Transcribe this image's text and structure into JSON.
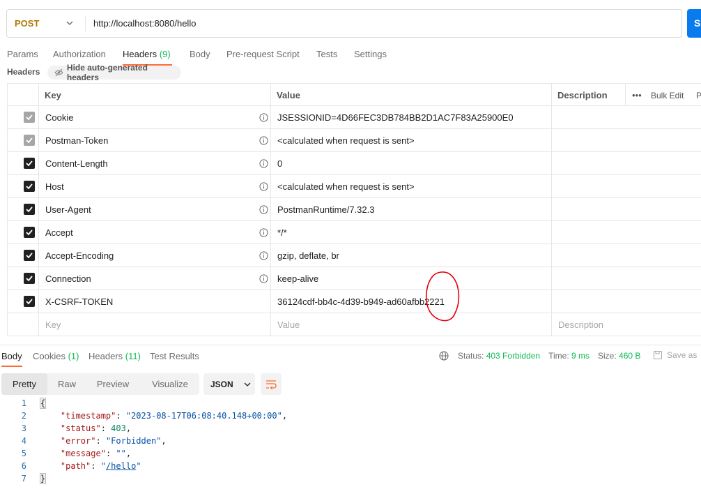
{
  "request": {
    "method": "POST",
    "url": "http://localhost:8080/hello",
    "send_label": "S"
  },
  "request_tabs": {
    "params": "Params",
    "authorization": "Authorization",
    "headers": "Headers",
    "headers_count": "(9)",
    "body": "Body",
    "prerequest": "Pre-request Script",
    "tests": "Tests",
    "settings": "Settings"
  },
  "headers_section": {
    "title": "Headers",
    "hide_auto": "Hide auto-generated headers"
  },
  "table": {
    "col_key": "Key",
    "col_value": "Value",
    "col_description": "Description",
    "bulk_edit": "Bulk Edit",
    "presets": "P",
    "rows": [
      {
        "checked": true,
        "auto": true,
        "key": "Cookie",
        "value": "JSESSIONID=4D66FEC3DB784BB2D1AC7F83A25900E0"
      },
      {
        "checked": true,
        "auto": true,
        "key": "Postman-Token",
        "value": "<calculated when request is sent>"
      },
      {
        "checked": true,
        "auto": false,
        "key": "Content-Length",
        "value": "0"
      },
      {
        "checked": true,
        "auto": false,
        "key": "Host",
        "value": "<calculated when request is sent>"
      },
      {
        "checked": true,
        "auto": false,
        "key": "User-Agent",
        "value": "PostmanRuntime/7.32.3"
      },
      {
        "checked": true,
        "auto": false,
        "key": "Accept",
        "value": "*/*"
      },
      {
        "checked": true,
        "auto": false,
        "key": "Accept-Encoding",
        "value": "gzip, deflate, br"
      },
      {
        "checked": true,
        "auto": false,
        "key": "Connection",
        "value": "keep-alive"
      },
      {
        "checked": true,
        "auto": false,
        "key": "X-CSRF-TOKEN",
        "value": "36124cdf-bb4c-4d39-b949-ad60afbb2221"
      }
    ],
    "placeholder_key": "Key",
    "placeholder_value": "Value",
    "placeholder_description": "Description"
  },
  "response": {
    "tabs": {
      "body": "Body",
      "cookies": "Cookies",
      "cookies_count": "(1)",
      "headers": "Headers",
      "headers_count": "(11)",
      "test_results": "Test Results"
    },
    "status_label": "Status:",
    "status_value": "403 Forbidden",
    "time_label": "Time:",
    "time_value": "9 ms",
    "size_label": "Size:",
    "size_value": "460 B",
    "save_as": "Save as"
  },
  "view": {
    "pretty": "Pretty",
    "raw": "Raw",
    "preview": "Preview",
    "visualize": "Visualize",
    "format": "JSON"
  },
  "code": {
    "line_numbers": [
      "1",
      "2",
      "3",
      "4",
      "5",
      "6",
      "7"
    ],
    "open_brace": "{",
    "close_brace": "}",
    "timestamp_key": "\"timestamp\"",
    "timestamp_value": "\"2023-08-17T06:08:40.148+00:00\"",
    "status_key": "\"status\"",
    "status_value": "403",
    "error_key": "\"error\"",
    "error_value": "\"Forbidden\"",
    "message_key": "\"message\"",
    "message_value": "\"\"",
    "path_key": "\"path\"",
    "path_value": "/hello"
  },
  "colors": {
    "accent_orange": "#ff6c37",
    "post_method": "#ad7a03",
    "send_blue": "#097bed",
    "count_green": "#0cbb52",
    "annotation_red": "#e8000b"
  }
}
